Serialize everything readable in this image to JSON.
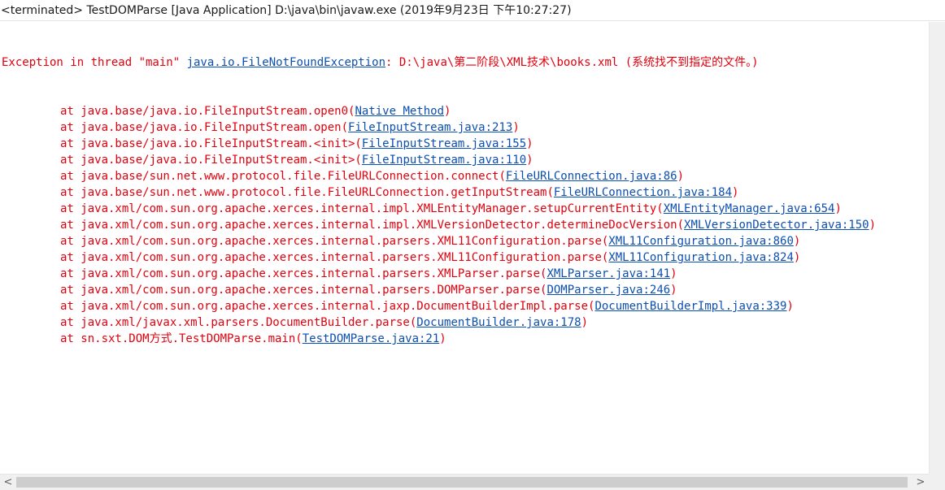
{
  "header": {
    "status_title": "<terminated> TestDOMParse [Java Application] D:\\java\\bin\\javaw.exe (2019年9月23日 下午10:27:27)"
  },
  "exception": {
    "prefix": "Exception in thread \"main\" ",
    "exception_link": "java.io.FileNotFoundException",
    "message": ": D:\\java\\第二阶段\\XML技术\\books.xml (系统找不到指定的文件。)"
  },
  "stack_frames": [
    {
      "method": "at java.base/java.io.FileInputStream.open0(",
      "source": "Native Method",
      "suffix": ")"
    },
    {
      "method": "at java.base/java.io.FileInputStream.open(",
      "source": "FileInputStream.java:213",
      "suffix": ")"
    },
    {
      "method": "at java.base/java.io.FileInputStream.<init>(",
      "source": "FileInputStream.java:155",
      "suffix": ")"
    },
    {
      "method": "at java.base/java.io.FileInputStream.<init>(",
      "source": "FileInputStream.java:110",
      "suffix": ")"
    },
    {
      "method": "at java.base/sun.net.www.protocol.file.FileURLConnection.connect(",
      "source": "FileURLConnection.java:86",
      "suffix": ")"
    },
    {
      "method": "at java.base/sun.net.www.protocol.file.FileURLConnection.getInputStream(",
      "source": "FileURLConnection.java:184",
      "suffix": ")"
    },
    {
      "method": "at java.xml/com.sun.org.apache.xerces.internal.impl.XMLEntityManager.setupCurrentEntity(",
      "source": "XMLEntityManager.java:654",
      "suffix": ")"
    },
    {
      "method": "at java.xml/com.sun.org.apache.xerces.internal.impl.XMLVersionDetector.determineDocVersion(",
      "source": "XMLVersionDetector.java:150",
      "suffix": ")"
    },
    {
      "method": "at java.xml/com.sun.org.apache.xerces.internal.parsers.XML11Configuration.parse(",
      "source": "XML11Configuration.java:860",
      "suffix": ")"
    },
    {
      "method": "at java.xml/com.sun.org.apache.xerces.internal.parsers.XML11Configuration.parse(",
      "source": "XML11Configuration.java:824",
      "suffix": ")"
    },
    {
      "method": "at java.xml/com.sun.org.apache.xerces.internal.parsers.XMLParser.parse(",
      "source": "XMLParser.java:141",
      "suffix": ")"
    },
    {
      "method": "at java.xml/com.sun.org.apache.xerces.internal.parsers.DOMParser.parse(",
      "source": "DOMParser.java:246",
      "suffix": ")"
    },
    {
      "method": "at java.xml/com.sun.org.apache.xerces.internal.jaxp.DocumentBuilderImpl.parse(",
      "source": "DocumentBuilderImpl.java:339",
      "suffix": ")"
    },
    {
      "method": "at java.xml/javax.xml.parsers.DocumentBuilder.parse(",
      "source": "DocumentBuilder.java:178",
      "suffix": ")"
    },
    {
      "method": "at sn.sxt.DOM方式.TestDOMParse.main(",
      "source": "TestDOMParse.java:21",
      "suffix": ")"
    }
  ],
  "scrollbar": {
    "left_arrow": "<",
    "right_arrow": ">"
  },
  "colors": {
    "error_text": "#e2000d",
    "link_text": "#0b4fb3",
    "scrollbar_track": "#f0f0f0",
    "scrollbar_thumb": "#cdcdcd"
  }
}
